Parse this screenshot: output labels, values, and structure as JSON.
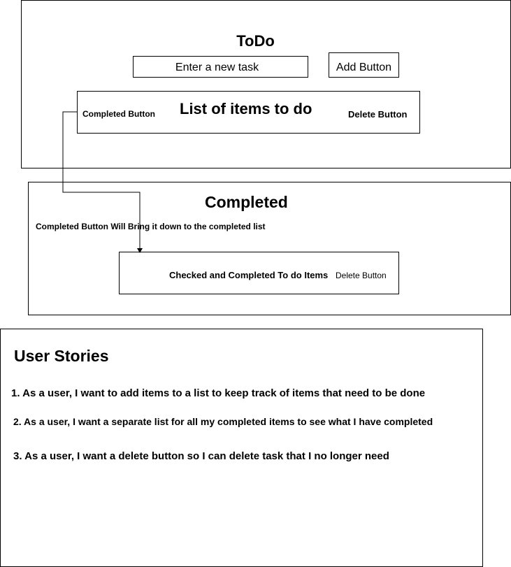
{
  "todo": {
    "title": "ToDo",
    "input_placeholder": "Enter a new task",
    "add_button": "Add Button",
    "list_title": "List of items to do",
    "completed_button": "Completed Button",
    "delete_button": "Delete Button"
  },
  "completed": {
    "title": "Completed",
    "note": "Completed Button Will Bring it down to the completed list",
    "item_text": "Checked and Completed To do Items",
    "delete_button": "Delete Button"
  },
  "user_stories": {
    "title": "User Stories",
    "items": [
      "1. As a user, I want to add items to a list to keep track of items that need to be done",
      "2. As a user, I want a separate list for all my completed items to see what I have completed",
      "3. As a user, I want a delete button so I can delete task that I no longer need"
    ]
  }
}
